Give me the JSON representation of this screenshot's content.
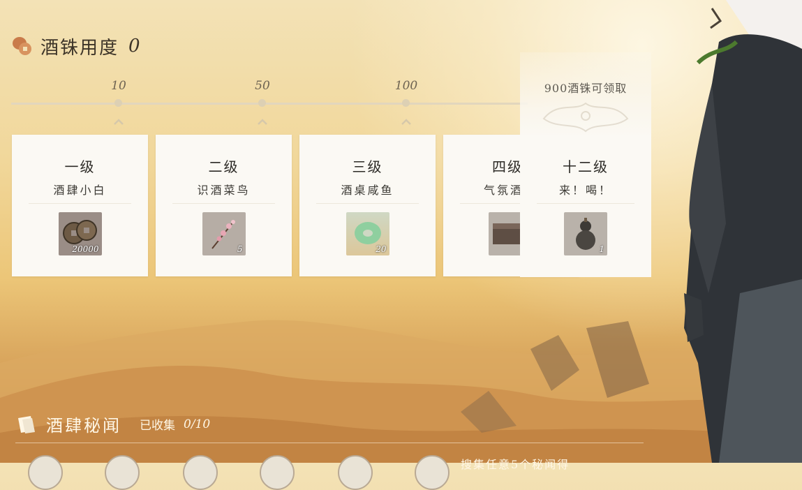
{
  "header": {
    "title": "酒铢用度",
    "value": "0",
    "icon": "coin-jar-icon"
  },
  "milestones": [
    {
      "label": "10"
    },
    {
      "label": "50"
    },
    {
      "label": "100"
    }
  ],
  "cards": [
    {
      "level": "一级",
      "title": "酒肆小白",
      "reward_icon": "copper-coins-icon",
      "count": "20000"
    },
    {
      "level": "二级",
      "title": "识酒菜鸟",
      "reward_icon": "plum-blossom-branch-icon",
      "count": "5"
    },
    {
      "level": "三级",
      "title": "酒桌咸鱼",
      "reward_icon": "jade-ring-icon",
      "count": "20"
    },
    {
      "level": "四级",
      "title": "气氛酒",
      "reward_icon": "wooden-chest-icon",
      "count": ""
    }
  ],
  "special": {
    "label": "900酒铢可领取",
    "level": "十二级",
    "title": "来！喝！",
    "reward_icon": "wine-gourd-icon",
    "count": "1"
  },
  "bottom": {
    "title": "酒肆秘闻",
    "collected_label": "已收集",
    "collected_value": "0/10",
    "task_text": "搜集任意5个秘闻得"
  },
  "colors": {
    "card": "#fbf9f4",
    "text": "#2c2a26",
    "sand": "#d9a45e"
  }
}
